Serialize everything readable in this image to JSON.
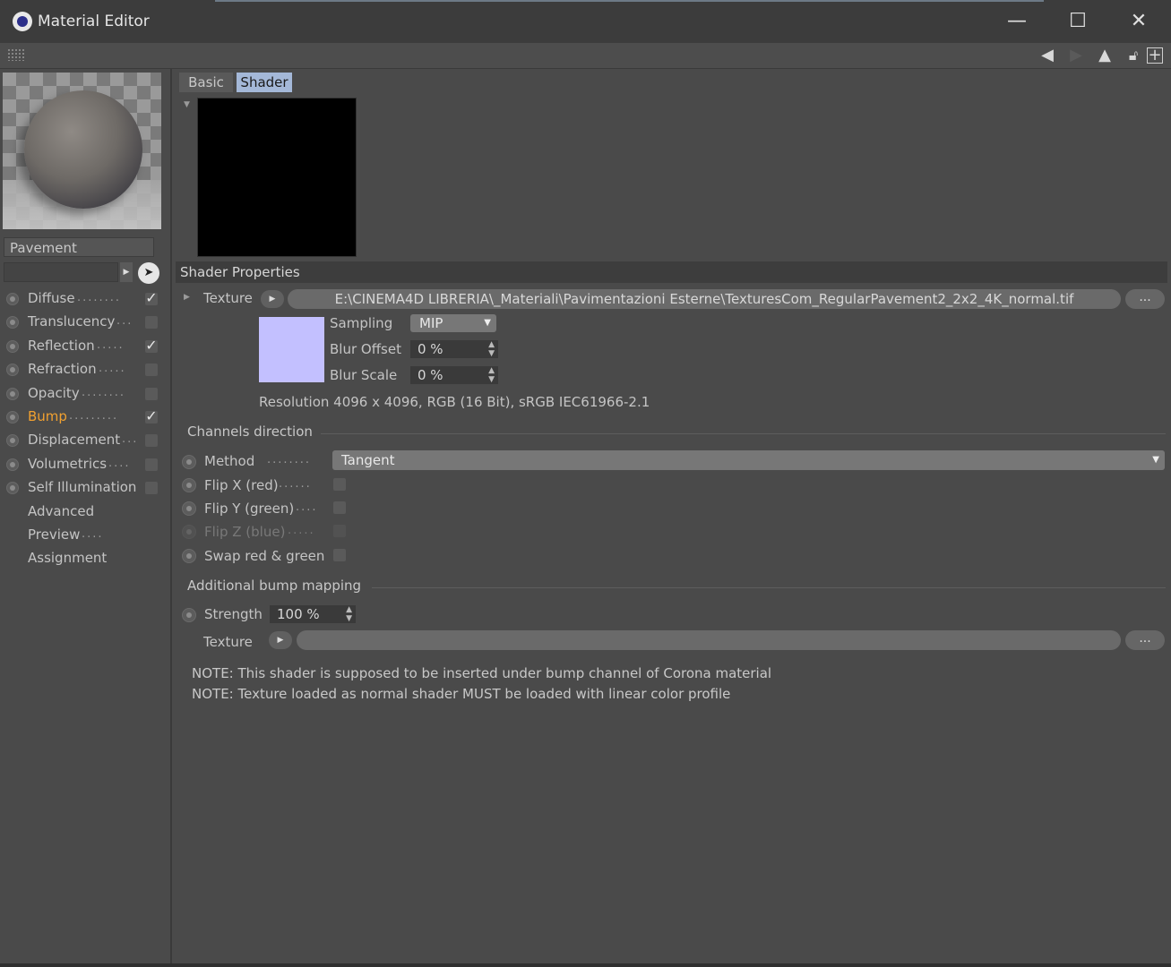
{
  "window": {
    "title": "Material Editor",
    "minimize_glyph": "—",
    "maximize_glyph": "☐",
    "close_glyph": "✕"
  },
  "toolbar": {
    "icons": [
      "arrow-left-icon",
      "arrow-up-icon",
      "lock-icon",
      "new-window-icon"
    ]
  },
  "material": {
    "name": "Pavement",
    "channels": [
      {
        "label": "Diffuse",
        "dots": "........",
        "checked": true
      },
      {
        "label": "Translucency",
        "dots": "...",
        "checked": false
      },
      {
        "label": "Reflection",
        "dots": ".....",
        "checked": true
      },
      {
        "label": "Refraction",
        "dots": ".....",
        "checked": false
      },
      {
        "label": "Opacity",
        "dots": "........",
        "checked": false
      },
      {
        "label": "Bump",
        "dots": ".........",
        "checked": true,
        "active": true
      },
      {
        "label": "Displacement",
        "dots": "...",
        "checked": false
      },
      {
        "label": "Volumetrics",
        "dots": "....",
        "checked": false
      },
      {
        "label": "Self Illumination",
        "dots": "",
        "checked": false
      },
      {
        "label": "Advanced",
        "dots": ""
      },
      {
        "label": "Preview",
        "dots": "...."
      },
      {
        "label": "Assignment",
        "dots": ""
      }
    ]
  },
  "tabs": {
    "basic": "Basic",
    "shader": "Shader"
  },
  "shader_properties": {
    "heading": "Shader Properties",
    "texture_label": "Texture",
    "texture_path": "E:\\CINEMA4D LIBRERIA\\_Materiali\\Pavimentazioni Esterne\\TexturesCom_RegularPavement2_2x2_4K_normal.tif",
    "browse_label": "...",
    "sampling_label": "Sampling",
    "sampling_value": "MIP",
    "blur_offset_label": "Blur Offset",
    "blur_offset_value": "0 %",
    "blur_scale_label": "Blur Scale",
    "blur_scale_value": "0 %",
    "resolution": "Resolution 4096 x 4096, RGB (16 Bit), sRGB IEC61966-2.1",
    "swatch_color": "#c3c0ff"
  },
  "channels_direction": {
    "heading": "Channels direction",
    "method_label": "Method",
    "method_dots": "........",
    "method_value": "Tangent",
    "flip_x_label": "Flip X (red)",
    "flip_x_dots": "......",
    "flip_y_label": "Flip Y (green)",
    "flip_y_dots": "....",
    "flip_z_label": "Flip Z (blue)",
    "flip_z_dots": ".....",
    "swap_label": "Swap red & green"
  },
  "additional_bump": {
    "heading": "Additional bump mapping",
    "strength_label": "Strength",
    "strength_value": "100 %",
    "texture_label": "Texture",
    "browse_label": "..."
  },
  "notes": [
    "NOTE: This shader is supposed to be inserted under bump channel of Corona material",
    "NOTE: Texture loaded as normal shader MUST be loaded with linear color profile"
  ],
  "colors": {
    "accent_active": "#f0a030",
    "tab_selected": "#a4b8d8",
    "background": "#4a4a4a"
  }
}
